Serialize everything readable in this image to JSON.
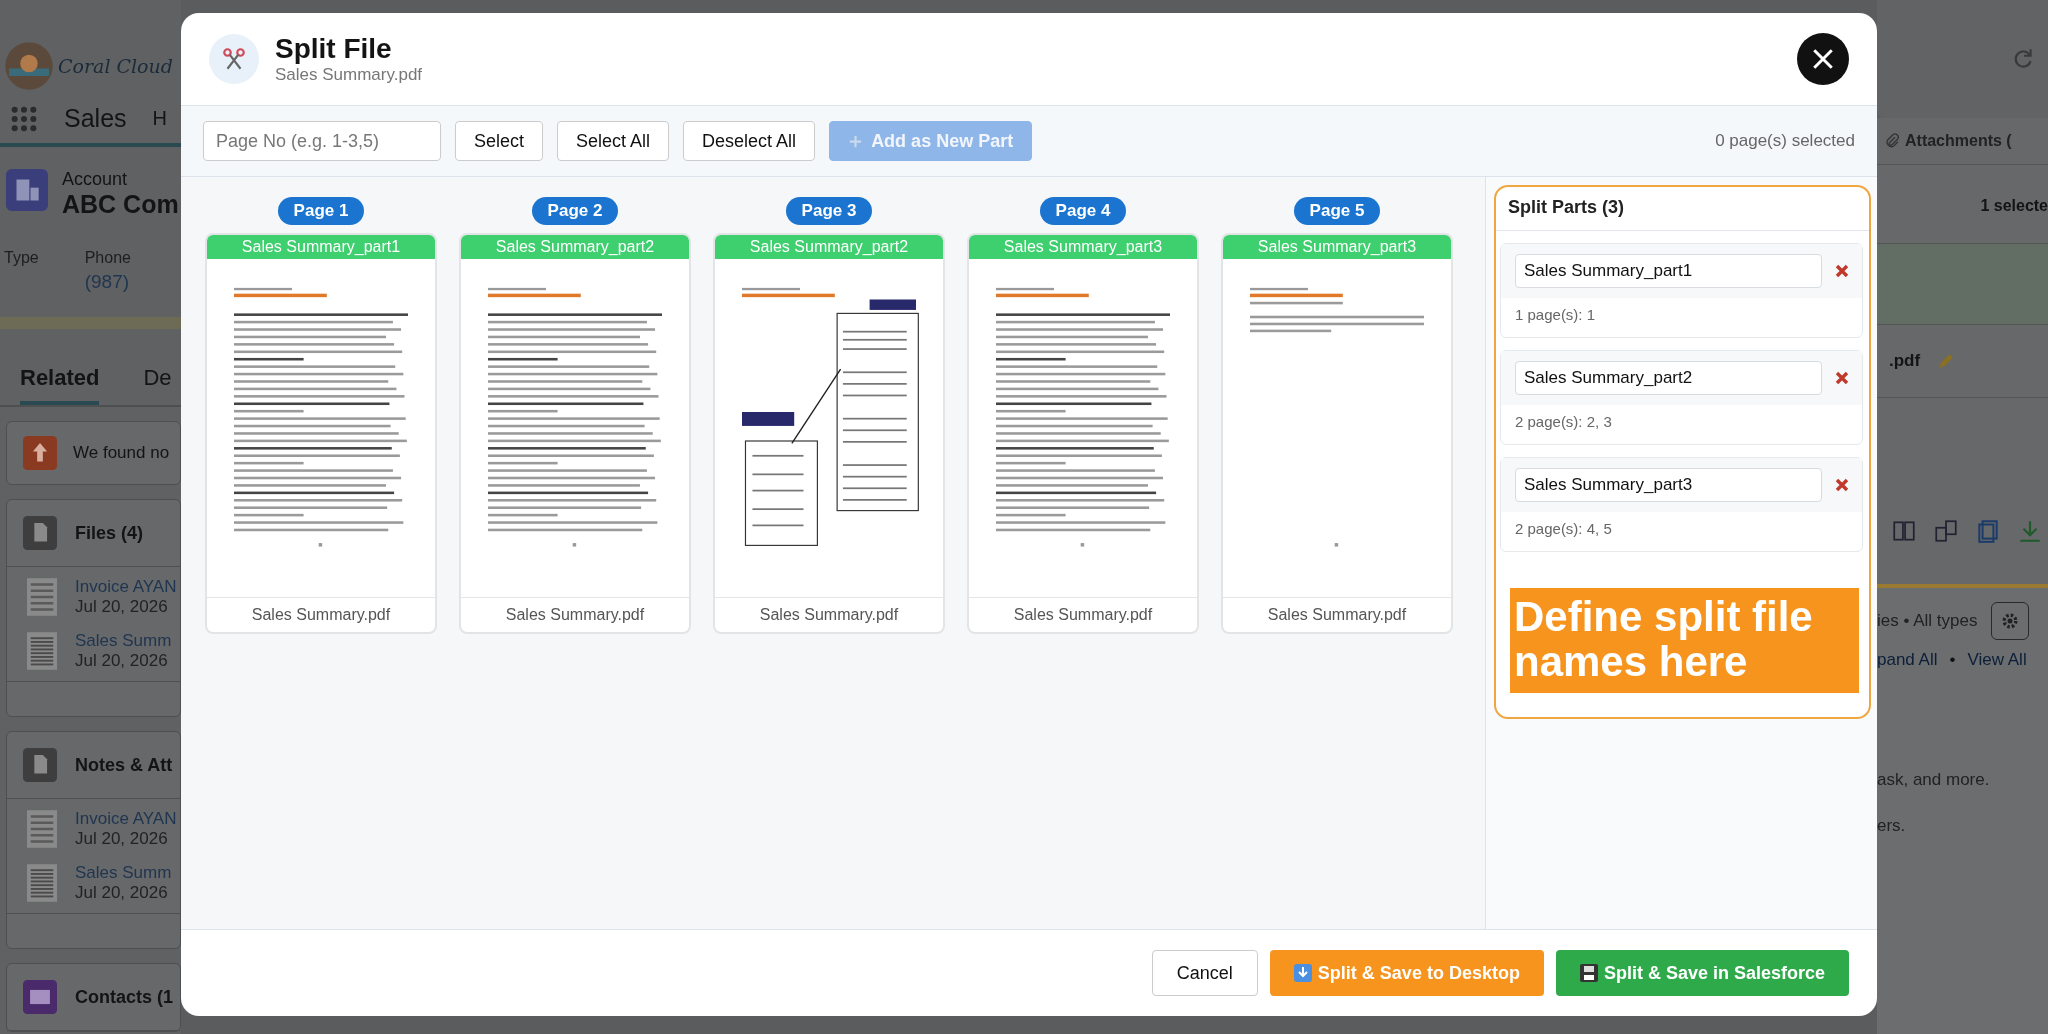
{
  "background": {
    "logo_text": "Coral Cloud",
    "app_name": "Sales",
    "nav_items": [
      "H"
    ],
    "record": {
      "type": "Account",
      "name": "ABC Com"
    },
    "fields": [
      {
        "label": "Type"
      },
      {
        "label": "Phone",
        "value": "(987)"
      }
    ],
    "tabs": [
      {
        "label": "Related",
        "selected": true
      },
      {
        "label": "De",
        "selected": false
      }
    ],
    "notice": "We found no",
    "cards": [
      {
        "kind": "files",
        "title": "Files (4)",
        "items": [
          {
            "name": "Invoice AYAN",
            "date": "Jul 20, 2026",
            "kind": "invoice"
          },
          {
            "name": "Sales Summ",
            "date": "Jul 20, 2026",
            "kind": "document"
          }
        ]
      },
      {
        "kind": "files",
        "title": "Notes & Att",
        "items": [
          {
            "name": "Invoice AYAN",
            "date": "Jul 20, 2026",
            "kind": "invoice"
          },
          {
            "name": "Sales Summ",
            "date": "Jul 20, 2026",
            "kind": "document"
          }
        ]
      },
      {
        "kind": "contacts",
        "title": "Contacts (1"
      }
    ],
    "right": {
      "attachments_tab": "Attachments (",
      "selection": "1 selecte",
      "file_name": ".pdf",
      "filter": "ies • All types",
      "links": [
        "pand All",
        "View All"
      ],
      "link_separator": "•",
      "texts": [
        "ask, and more.",
        "ers."
      ]
    }
  },
  "modal": {
    "title": "Split File",
    "subtitle": "Sales Summary.pdf",
    "toolbar": {
      "page_input": {
        "placeholder": "Page No (e.g. 1-3,5)"
      },
      "buttons": [
        {
          "label": "Select",
          "kind": "plain",
          "disabled": false
        },
        {
          "label": "Select All",
          "kind": "plain",
          "disabled": false
        },
        {
          "label": "Deselect All",
          "kind": "plain",
          "disabled": false
        },
        {
          "label": "Add as New Part",
          "kind": "add",
          "disabled": true
        }
      ],
      "selection_count": "0 page(s) selected"
    },
    "pages": [
      {
        "badge": "Page 1",
        "part": "Sales Summary_part1",
        "file": "Sales Summary.pdf",
        "kind": "text"
      },
      {
        "badge": "Page 2",
        "part": "Sales Summary_part2",
        "file": "Sales Summary.pdf",
        "kind": "text"
      },
      {
        "badge": "Page 3",
        "part": "Sales Summary_part2",
        "file": "Sales Summary.pdf",
        "kind": "diagram"
      },
      {
        "badge": "Page 4",
        "part": "Sales Summary_part3",
        "file": "Sales Summary.pdf",
        "kind": "text"
      },
      {
        "badge": "Page 5",
        "part": "Sales Summary_part3",
        "file": "Sales Summary.pdf",
        "kind": "short"
      }
    ],
    "split_parts": {
      "title": "Split Parts (3)",
      "parts": [
        {
          "name": "Sales Summary_part1",
          "pages": "1 page(s): 1"
        },
        {
          "name": "Sales Summary_part2",
          "pages": "2 page(s): 2, 3"
        },
        {
          "name": "Sales Summary_part3",
          "pages": "2 page(s): 4, 5"
        }
      ]
    },
    "callout": "Define split file names here",
    "footer": {
      "cancel": "Cancel",
      "actions": [
        {
          "label": "Split & Save to Desktop",
          "kind": "desktop"
        },
        {
          "label": "Split & Save in Salesforce",
          "kind": "salesforce"
        }
      ]
    }
  }
}
